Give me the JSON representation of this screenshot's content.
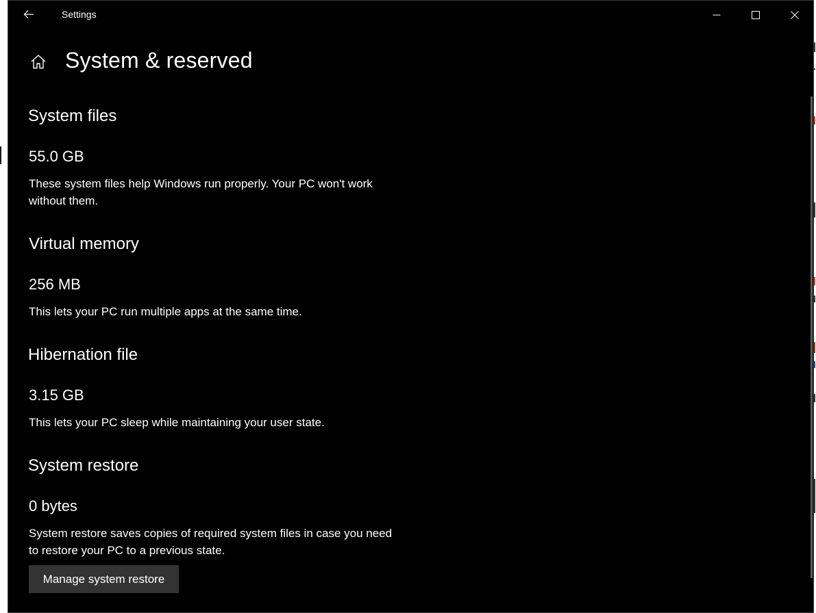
{
  "window": {
    "title": "Settings"
  },
  "icons": {
    "back": "back-arrow-icon",
    "home": "home-icon",
    "minimize": "minimize-icon",
    "maximize": "maximize-icon",
    "close": "close-icon"
  },
  "page": {
    "title": "System & reserved"
  },
  "sections": {
    "system_files": {
      "heading": "System files",
      "size": "55.0 GB",
      "description": "These system files help Windows run properly. Your PC won't work without them."
    },
    "virtual_memory": {
      "heading": "Virtual memory",
      "size": "256 MB",
      "description": "This lets your PC run multiple apps at the same time."
    },
    "hibernation_file": {
      "heading": "Hibernation file",
      "size": "3.15 GB",
      "description": "This lets your PC sleep while maintaining your user state."
    },
    "system_restore": {
      "heading": "System restore",
      "size": "0 bytes",
      "description": "System restore saves copies of required system files in case you need to restore your PC to a previous state.",
      "button_label": "Manage system restore"
    }
  },
  "colors": {
    "background": "#000000",
    "text": "#ffffff",
    "button_background": "#333333"
  }
}
